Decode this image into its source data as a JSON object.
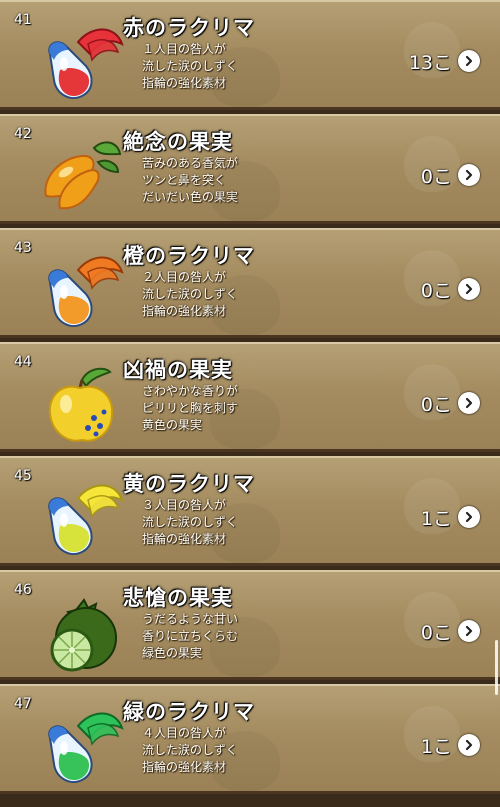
{
  "items": [
    {
      "number": "41",
      "name": "赤のラクリマ",
      "desc": [
        "１人目の咎人が",
        "流した涙のしずく",
        "指輪の強化素材"
      ],
      "count": "13こ",
      "icon": "red-lacrima-icon",
      "kind": "lacrima",
      "wing": "#e8323a",
      "wing_dark": "#8e1018",
      "liquid": "#e5363a"
    },
    {
      "number": "42",
      "name": "絶念の果実",
      "desc": [
        "苦みのある香気が",
        "ツンと鼻を突く",
        "だいだい色の果実"
      ],
      "count": "0こ",
      "icon": "orange-fruit-icon",
      "kind": "mango",
      "fruit": "#f0a018",
      "fruit_dark": "#c06010"
    },
    {
      "number": "43",
      "name": "橙のラクリマ",
      "desc": [
        "２人目の咎人が",
        "流した涙のしずく",
        "指輪の強化素材"
      ],
      "count": "0こ",
      "icon": "orange-lacrima-icon",
      "kind": "lacrima",
      "wing": "#f07a22",
      "wing_dark": "#9a3a08",
      "liquid": "#f29a2a"
    },
    {
      "number": "44",
      "name": "凶禍の果実",
      "desc": [
        "さわやかな香りが",
        "ピリリと胸を刺す",
        "黄色の果実"
      ],
      "count": "0こ",
      "icon": "yellow-fruit-icon",
      "kind": "apple",
      "fruit": "#f2cf2a",
      "fruit_dark": "#c79a10"
    },
    {
      "number": "45",
      "name": "黄のラクリマ",
      "desc": [
        "３人目の咎人が",
        "流した涙のしずく",
        "指輪の強化素材"
      ],
      "count": "1こ",
      "icon": "yellow-lacrima-icon",
      "kind": "lacrima",
      "wing": "#f6e63a",
      "wing_dark": "#a89612",
      "liquid": "#d7e23a"
    },
    {
      "number": "46",
      "name": "悲愴の果実",
      "desc": [
        "うだるような甘い",
        "香りに立ちくらむ",
        "緑色の果実"
      ],
      "count": "0こ",
      "icon": "green-fruit-icon",
      "kind": "lime",
      "fruit": "#3a6a1a",
      "fruit_dark": "#173508"
    },
    {
      "number": "47",
      "name": "緑のラクリマ",
      "desc": [
        "４人目の咎人が",
        "流した涙のしずく",
        "指輪の強化素材"
      ],
      "count": "1こ",
      "icon": "green-lacrima-icon",
      "kind": "lacrima",
      "wing": "#2ec25a",
      "wing_dark": "#0e6a24",
      "liquid": "#38c25a"
    }
  ]
}
